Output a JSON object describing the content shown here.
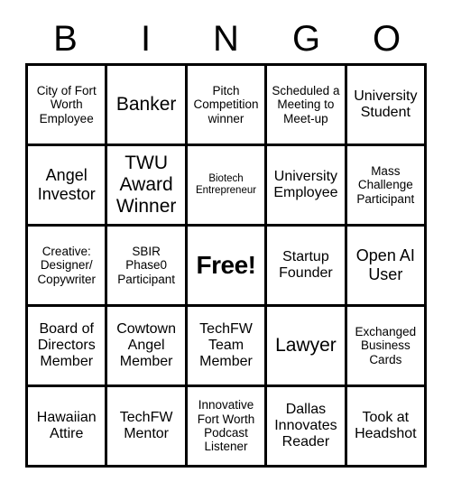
{
  "card": {
    "title": "Bingo Card",
    "header_letters": [
      "B",
      "I",
      "N",
      "G",
      "O"
    ],
    "columns": 5,
    "rows": 5,
    "colors": {
      "border": "#000000",
      "cell_background": "#ffffff",
      "text": "#000000",
      "page_background": "#ffffff"
    },
    "free_space": {
      "row": 2,
      "col": 2,
      "label": "Free!"
    },
    "cells": [
      [
        {
          "text": "City of Fort Worth Employee",
          "size": "sm",
          "free": false
        },
        {
          "text": "Banker",
          "size": "xl",
          "free": false
        },
        {
          "text": "Pitch Competition winner",
          "size": "sm",
          "free": false
        },
        {
          "text": "Scheduled a Meeting to Meet-up",
          "size": "sm",
          "free": false
        },
        {
          "text": "University Student",
          "size": "md",
          "free": false
        }
      ],
      [
        {
          "text": "Angel Investor",
          "size": "lg",
          "free": false
        },
        {
          "text": "TWU Award Winner",
          "size": "xl",
          "free": false
        },
        {
          "text": "Biotech Entrepreneur",
          "size": "xs",
          "free": false
        },
        {
          "text": "University Employee",
          "size": "md",
          "free": false
        },
        {
          "text": "Mass Challenge Participant",
          "size": "sm",
          "free": false
        }
      ],
      [
        {
          "text": "Creative: Designer/ Copywriter",
          "size": "sm",
          "free": false
        },
        {
          "text": "SBIR Phase0 Participant",
          "size": "sm",
          "free": false
        },
        {
          "text": "Free!",
          "size": "xl",
          "free": true
        },
        {
          "text": "Startup Founder",
          "size": "md",
          "free": false
        },
        {
          "text": "Open AI User",
          "size": "lg",
          "free": false
        }
      ],
      [
        {
          "text": "Board of Directors Member",
          "size": "md",
          "free": false
        },
        {
          "text": "Cowtown Angel Member",
          "size": "md",
          "free": false
        },
        {
          "text": "TechFW Team Member",
          "size": "md",
          "free": false
        },
        {
          "text": "Lawyer",
          "size": "xl",
          "free": false
        },
        {
          "text": "Exchanged Business Cards",
          "size": "sm",
          "free": false
        }
      ],
      [
        {
          "text": "Hawaiian Attire",
          "size": "md",
          "free": false
        },
        {
          "text": "TechFW Mentor",
          "size": "md",
          "free": false
        },
        {
          "text": "Innovative Fort Worth Podcast Listener",
          "size": "sm",
          "free": false
        },
        {
          "text": "Dallas Innovates Reader",
          "size": "md",
          "free": false
        },
        {
          "text": "Took at Headshot",
          "size": "md",
          "free": false
        }
      ]
    ]
  }
}
